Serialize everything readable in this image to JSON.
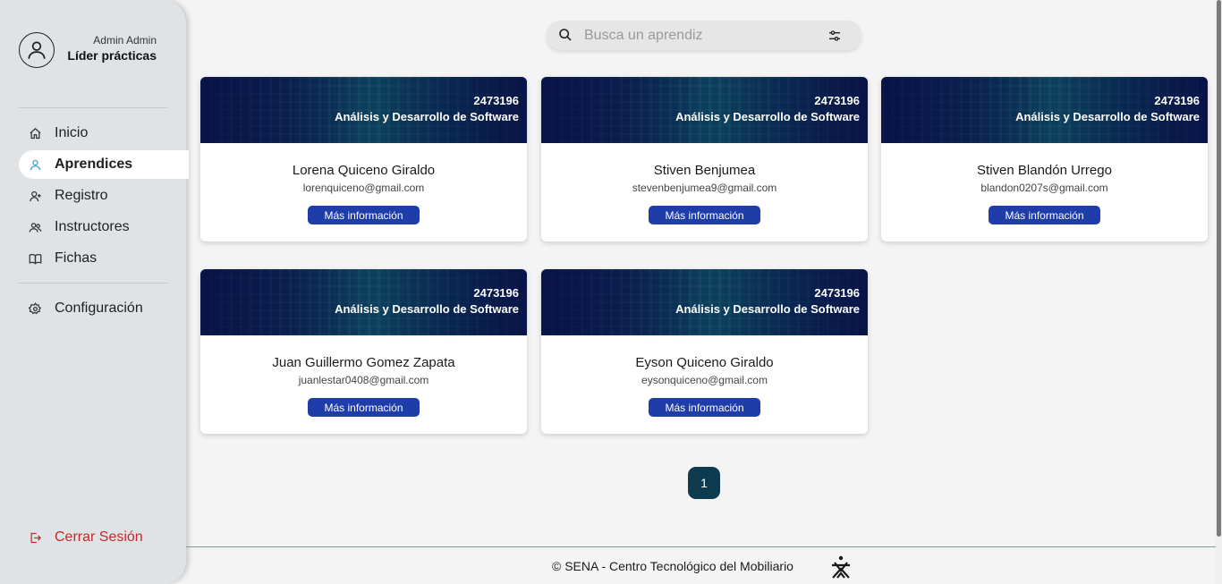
{
  "user": {
    "name": "Admin Admin",
    "role": "Líder prácticas"
  },
  "nav": {
    "items": [
      {
        "label": "Inicio",
        "icon": "home-icon"
      },
      {
        "label": "Aprendices",
        "icon": "user-icon",
        "active": true
      },
      {
        "label": "Registro",
        "icon": "user-add-icon"
      },
      {
        "label": "Instructores",
        "icon": "users-icon"
      },
      {
        "label": "Fichas",
        "icon": "book-icon"
      }
    ],
    "settings": {
      "label": "Configuración",
      "icon": "gear-icon"
    },
    "logout": {
      "label": "Cerrar Sesión",
      "icon": "logout-icon"
    }
  },
  "search": {
    "placeholder": "Busca un aprendiz",
    "value": ""
  },
  "cards": [
    {
      "code": "2473196",
      "program": "Análisis y Desarrollo de Software",
      "name": "Lorena Quiceno Giraldo",
      "email": "lorenquiceno@gmail.com",
      "button": "Más información"
    },
    {
      "code": "2473196",
      "program": "Análisis y Desarrollo de Software",
      "name": "Stiven Benjumea",
      "email": "stevenbenjumea9@gmail.com",
      "button": "Más información"
    },
    {
      "code": "2473196",
      "program": "Análisis y Desarrollo de Software",
      "name": "Stiven Blandón Urrego",
      "email": "blandon0207s@gmail.com",
      "button": "Más información"
    },
    {
      "code": "2473196",
      "program": "Análisis y Desarrollo de Software",
      "name": "Juan Guillermo Gomez Zapata",
      "email": "juanlestar0408@gmail.com",
      "button": "Más información"
    },
    {
      "code": "2473196",
      "program": "Análisis y Desarrollo de Software",
      "name": "Eyson Quiceno Giraldo",
      "email": "eysonquiceno@gmail.com",
      "button": "Más información"
    }
  ],
  "pagination": {
    "current": "1"
  },
  "footer": {
    "text": "© SENA - Centro Tecnológico del Mobiliario",
    "logo": "SENA"
  },
  "colors": {
    "accent": "#1f3da8",
    "page_button": "#0d3a4f",
    "logout": "#c62828",
    "sidebar": "#e0e3e6"
  }
}
